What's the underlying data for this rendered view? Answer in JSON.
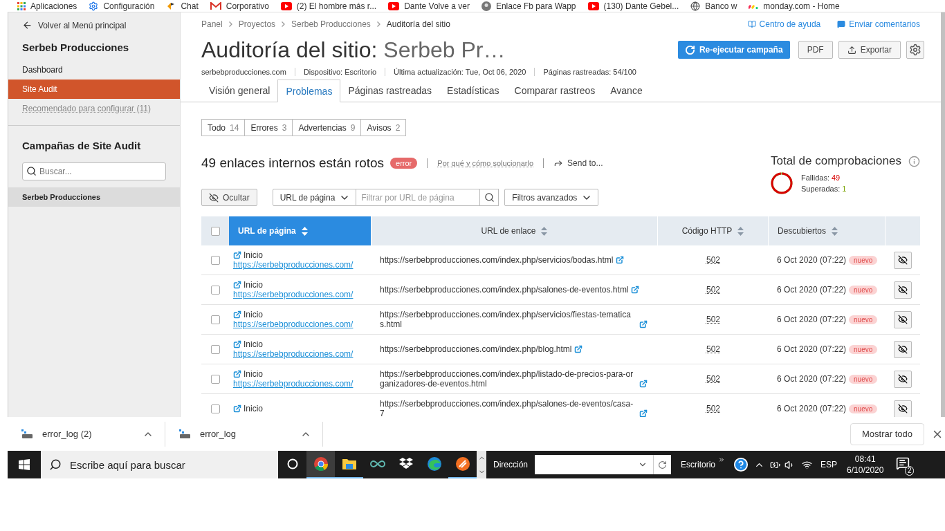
{
  "bookmarks": [
    {
      "kind": "apps",
      "label": "Aplicaciones"
    },
    {
      "kind": "gear",
      "label": "Configuración"
    },
    {
      "kind": "chat",
      "label": "Chat"
    },
    {
      "kind": "mail",
      "label": "Corporativo"
    },
    {
      "kind": "video",
      "label": "(2) El hombre más r..."
    },
    {
      "kind": "video",
      "label": "Dante Volve a ver"
    },
    {
      "kind": "avatar",
      "label": "Enlace Fb para Wapp"
    },
    {
      "kind": "video",
      "label": "(130) Dante Gebel..."
    },
    {
      "kind": "globe",
      "label": "Banco w"
    },
    {
      "kind": "dots",
      "label": "monday.com - Home"
    }
  ],
  "sidebar": {
    "back": "Volver al Menú principal",
    "project": "Serbeb Producciones",
    "items": [
      {
        "label": "Dashboard",
        "selected": false,
        "disabled": false
      },
      {
        "label": "Site Audit",
        "selected": true,
        "disabled": false
      },
      {
        "label": "Recomendado para configurar (11)",
        "selected": false,
        "disabled": true
      }
    ],
    "campaigns_title": "Campañas de Site Audit",
    "search_placeholder": "Buscar...",
    "campaigns": [
      {
        "label": "Serbeb Producciones",
        "selected": true
      }
    ]
  },
  "breadcrumb": [
    "Panel",
    "Proyectos",
    "Serbeb Producciones",
    "Auditoría del sitio"
  ],
  "help_links": [
    {
      "kind": "book",
      "label": "Centro de ayuda"
    },
    {
      "kind": "comment",
      "label": "Enviar comentarios"
    }
  ],
  "title": "Auditoría del sitio:",
  "title_project": "Serbeb Pr…",
  "actions": {
    "rerun": "Re-ejecutar campaña",
    "pdf": "PDF",
    "export": "Exportar"
  },
  "meta": [
    "serbebproducciones.com",
    "Dispositivo: Escritorio",
    "Última actualización: Tue, Oct 06, 2020",
    "Páginas rastreadas: 54/100"
  ],
  "tabs": [
    {
      "label": "Visión general",
      "selected": false
    },
    {
      "label": "Problemas",
      "selected": true
    },
    {
      "label": "Páginas rastreadas",
      "selected": false
    },
    {
      "label": "Estadísticas",
      "selected": false
    },
    {
      "label": "Comparar rastreos",
      "selected": false
    },
    {
      "label": "Avance",
      "selected": false
    }
  ],
  "filters": [
    {
      "label": "Todo",
      "count": "14"
    },
    {
      "label": "Errores",
      "count": "3"
    },
    {
      "label": "Advertencias",
      "count": "9"
    },
    {
      "label": "Avisos",
      "count": "2"
    }
  ],
  "issue": {
    "title": "49 enlaces internos están rotos",
    "badge": "error",
    "help_link": "Por qué y cómo solucionarlo",
    "send": "Send to..."
  },
  "checks": {
    "title": "Total de comprobaciones",
    "failed_label": "Fallidas:",
    "failed": "49",
    "passed_label": "Superadas:",
    "passed": "1"
  },
  "select_all": {
    "checked": false
  },
  "toolbar": {
    "hide": "Ocultar",
    "select": "URL de página",
    "filter_placeholder": "Filtrar por URL de página",
    "advanced": "Filtros avanzados"
  },
  "columns": [
    {
      "label": "URL de página",
      "selected": true
    },
    {
      "label": "URL de enlace",
      "selected": false
    },
    {
      "label": "Código HTTP",
      "selected": false
    },
    {
      "label": "Descubiertos",
      "selected": false
    }
  ],
  "rows": [
    {
      "checked": false,
      "page_title": "Inicio",
      "page_url": "https://serbebproducciones.com/",
      "link_url": "https://serbebproducciones.com/index.php/servicios/bodas.html",
      "code": "502",
      "date": "6 Oct 2020 (07:22)",
      "badge": "nuevo"
    },
    {
      "checked": false,
      "page_title": "Inicio",
      "page_url": "https://serbebproducciones.com/",
      "link_url": "https://serbebproducciones.com/index.php/salones-de-eventos.html",
      "code": "502",
      "date": "6 Oct 2020 (07:22)",
      "badge": "nuevo"
    },
    {
      "checked": false,
      "page_title": "Inicio",
      "page_url": "https://serbebproducciones.com/",
      "link_url": "https://serbebproducciones.com/index.php/servicios/fiestas-tematicas.html",
      "code": "502",
      "date": "6 Oct 2020 (07:22)",
      "badge": "nuevo"
    },
    {
      "checked": false,
      "page_title": "Inicio",
      "page_url": "https://serbebproducciones.com/",
      "link_url": "https://serbebproducciones.com/index.php/blog.html",
      "code": "502",
      "date": "6 Oct 2020 (07:22)",
      "badge": "nuevo"
    },
    {
      "checked": false,
      "page_title": "Inicio",
      "page_url": "https://serbebproducciones.com/",
      "link_url": "https://serbebproducciones.com/index.php/listado-de-precios-para-organizadores-de-eventos.html",
      "code": "502",
      "date": "6 Oct 2020 (07:22)",
      "badge": "nuevo"
    },
    {
      "checked": false,
      "page_title": "Inicio",
      "link_url": "https://serbebproducciones.com/index.php/salones-de-eventos/casa-7",
      "code": "502",
      "date": "6 Oct 2020 (07:22)",
      "badge": "nuevo"
    }
  ],
  "downloads": [
    "error_log (2)",
    "error_log"
  ],
  "show_all": "Mostrar todo",
  "taskbar": {
    "search_placeholder": "Escribe aquí para buscar",
    "apps": [
      {
        "kind": "chrome",
        "selected": true,
        "running": true
      },
      {
        "kind": "folder",
        "selected": false,
        "running": true
      },
      {
        "kind": "infinity",
        "selected": false,
        "running": false
      },
      {
        "kind": "dropbox",
        "selected": false,
        "running": false
      },
      {
        "kind": "edge",
        "selected": false,
        "running": false
      },
      {
        "kind": "orange",
        "selected": false,
        "running": true
      }
    ],
    "address_label": "Dirección",
    "desktop": "Escritorio",
    "lang": "ESP",
    "time": "08:41",
    "date": "6/10/2020",
    "notifications": "2"
  }
}
